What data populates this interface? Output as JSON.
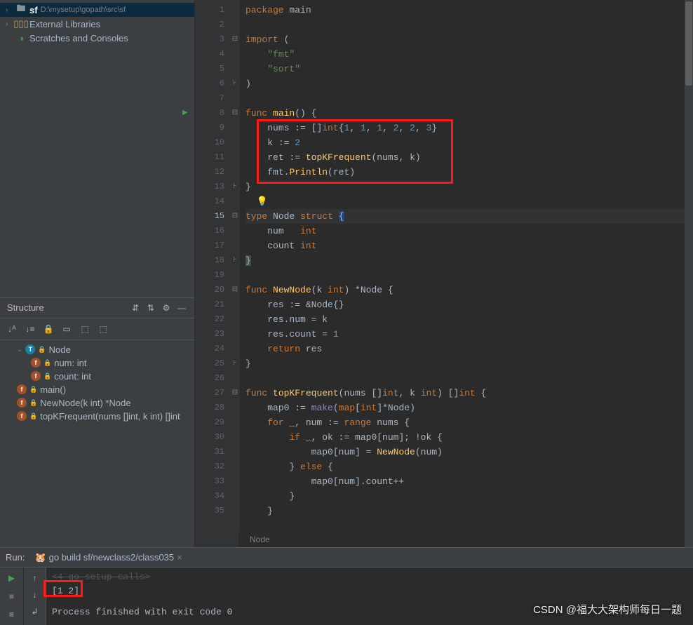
{
  "project": {
    "root": {
      "name": "sf",
      "path": "D:\\mysetup\\gopath\\src\\sf"
    },
    "external_libs": "External Libraries",
    "scratches": "Scratches and Consoles"
  },
  "structure": {
    "title": "Structure",
    "items": [
      {
        "kind": "type",
        "label": "Node",
        "indent": 1,
        "expanded": true
      },
      {
        "kind": "field",
        "label": "num: int",
        "indent": 2
      },
      {
        "kind": "field",
        "label": "count: int",
        "indent": 2
      },
      {
        "kind": "func",
        "label": "main()",
        "indent": 1
      },
      {
        "kind": "func",
        "label": "NewNode(k int) *Node",
        "indent": 1
      },
      {
        "kind": "func",
        "label": "topKFrequent(nums []int, k int) []int",
        "indent": 1
      }
    ]
  },
  "editor": {
    "breadcrumb": "Node",
    "runnable_line": 8,
    "current_line": 15,
    "lines": [
      {
        "n": 1,
        "fold": "",
        "html": "<span class='kw'>package</span> <span class='ident'>main</span>"
      },
      {
        "n": 2,
        "fold": "",
        "html": ""
      },
      {
        "n": 3,
        "fold": "⊟",
        "html": "<span class='kw'>import</span> ("
      },
      {
        "n": 4,
        "fold": "",
        "html": "    <span class='str'>\"fmt\"</span>"
      },
      {
        "n": 5,
        "fold": "",
        "html": "    <span class='str'>\"sort\"</span>"
      },
      {
        "n": 6,
        "fold": "⊦",
        "html": ")"
      },
      {
        "n": 7,
        "fold": "",
        "html": ""
      },
      {
        "n": 8,
        "fold": "⊟",
        "html": "<span class='kw'>func</span> <span class='fn'>main</span>() {"
      },
      {
        "n": 9,
        "fold": "",
        "html": "    <span class='ident'>nums</span> := []<span class='type'>int</span>{<span class='num'>1</span>, <span class='num'>1</span>, <span class='num'>1</span>, <span class='num'>2</span>, <span class='num'>2</span>, <span class='num'>3</span>}"
      },
      {
        "n": 10,
        "fold": "",
        "html": "    <span class='ident'>k</span> := <span class='num'>2</span>"
      },
      {
        "n": 11,
        "fold": "",
        "html": "    <span class='ident'>ret</span> := <span class='fn'>topKFrequent</span>(nums, k)"
      },
      {
        "n": 12,
        "fold": "",
        "html": "    <span class='ident'>fmt</span>.<span class='fn'>Println</span>(ret)"
      },
      {
        "n": 13,
        "fold": "⊦",
        "html": "}"
      },
      {
        "n": 14,
        "fold": "",
        "html": "  <span class='bulb'>💡</span>"
      },
      {
        "n": 15,
        "fold": "⊟",
        "html": "<span class='kw'>type</span> <span class='ident'>Node</span> <span class='kw'>struct</span> <span style='background:#214283'>{</span>"
      },
      {
        "n": 16,
        "fold": "",
        "html": "    <span class='ident'>num</span>   <span class='type'>int</span>"
      },
      {
        "n": 17,
        "fold": "",
        "html": "    <span class='ident'>count</span> <span class='type'>int</span>"
      },
      {
        "n": 18,
        "fold": "⊦",
        "html": "<span style='background:#3b514d'>}</span>"
      },
      {
        "n": 19,
        "fold": "",
        "html": ""
      },
      {
        "n": 20,
        "fold": "⊟",
        "html": "<span class='kw'>func</span> <span class='fn'>NewNode</span>(k <span class='type'>int</span>) *<span class='ident'>Node</span> {"
      },
      {
        "n": 21,
        "fold": "",
        "html": "    <span class='ident'>res</span> := &amp;<span class='ident'>Node</span>{}"
      },
      {
        "n": 22,
        "fold": "",
        "html": "    <span class='ident'>res</span>.num = k"
      },
      {
        "n": 23,
        "fold": "",
        "html": "    <span class='ident'>res</span>.count = <span class='num'>1</span>"
      },
      {
        "n": 24,
        "fold": "",
        "html": "    <span class='kw'>return</span> res"
      },
      {
        "n": 25,
        "fold": "⊦",
        "html": "}"
      },
      {
        "n": 26,
        "fold": "",
        "html": ""
      },
      {
        "n": 27,
        "fold": "⊟",
        "html": "<span class='kw'>func</span> <span class='fn'>topKFrequent</span>(nums []<span class='type'>int</span>, k <span class='type'>int</span>) []<span class='type'>int</span> {"
      },
      {
        "n": 28,
        "fold": "",
        "html": "    <span class='ident'>map0</span> := <span class='builtin'>make</span>(<span class='kw'>map</span>[<span class='type'>int</span>]*<span class='ident'>Node</span>)"
      },
      {
        "n": 29,
        "fold": "",
        "html": "    <span class='kw'>for</span> _, num := <span class='kw'>range</span> nums {"
      },
      {
        "n": 30,
        "fold": "",
        "html": "        <span class='kw'>if</span> _, ok := map0[num]; !ok {"
      },
      {
        "n": 31,
        "fold": "",
        "html": "            map0[num] = <span class='fn'>NewNode</span>(num)"
      },
      {
        "n": 32,
        "fold": "",
        "html": "        } <span class='kw'>else</span> {"
      },
      {
        "n": 33,
        "fold": "",
        "html": "            map0[num].count++"
      },
      {
        "n": 34,
        "fold": "",
        "html": "        }"
      },
      {
        "n": 35,
        "fold": "",
        "html": "    }"
      }
    ]
  },
  "run": {
    "label": "Run:",
    "tab": "go build sf/newclass2/class035",
    "setup_calls": "<4 go setup calls>",
    "output": "[1 2]",
    "exit": "Process finished with exit code 0"
  },
  "watermark": "CSDN @福大大架构师每日一题"
}
